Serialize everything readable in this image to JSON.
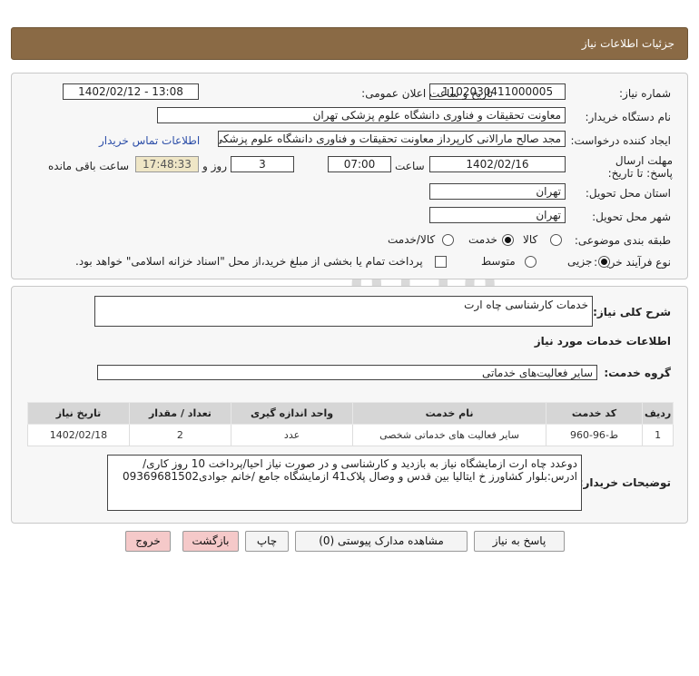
{
  "header": {
    "title": "جزئیات اطلاعات نیاز"
  },
  "form": {
    "need_number_label": "شماره نیاز:",
    "need_number": "1102030411000005",
    "announce_label": "تاریخ و ساعت اعلان عمومی:",
    "announce_value": "1402/02/12 - 13:08",
    "buyer_org_label": "نام دستگاه خریدار:",
    "buyer_org": "معاونت تحقیقات و فناوری دانشگاه علوم پزشکی تهران",
    "creator_label": "ایجاد کننده درخواست:",
    "creator": "مجد صالح مارالانی کارپرداز معاونت تحقیقات و فناوری دانشگاه علوم پزشکی تهران",
    "contact_link": "اطلاعات تماس خریدار",
    "deadline_label": "مهلت ارسال پاسخ: تا تاریخ:",
    "deadline_date": "1402/02/16",
    "time_label": "ساعت",
    "deadline_time": "07:00",
    "days": "3",
    "days_label": "روز و",
    "remaining": "17:48:33",
    "remaining_label": "ساعت باقی مانده",
    "province_label": "استان محل تحویل:",
    "province": "تهران",
    "city_label": "شهر محل تحویل:",
    "city": "تهران",
    "category_label": "طبقه بندی موضوعی:",
    "category_options": [
      "کالا",
      "خدمت",
      "کالا/خدمت"
    ],
    "category_selected": "خدمت",
    "process_label": "نوع فرآیند خرید :",
    "process_options": [
      "جزیی",
      "متوسط"
    ],
    "process_selected": "جزیی",
    "payment_note": "پرداخت تمام یا بخشی از مبلغ خرید،از محل \"اسناد خزانه اسلامی\" خواهد بود."
  },
  "details": {
    "summary_label": "شرح کلی نیاز:",
    "summary": "خدمات کارشناسی چاه ارت",
    "services_heading": "اطلاعات خدمات مورد نیاز",
    "service_group_label": "گروه خدمت:",
    "service_group": "سایر فعالیت‌های خدماتی",
    "table": {
      "headers": [
        "ردیف",
        "کد خدمت",
        "نام خدمت",
        "واحد اندازه گیری",
        "تعداد / مقدار",
        "تاریخ نیاز"
      ],
      "rows": [
        [
          "1",
          "ط-96-960",
          "سایر فعالیت های خدماتی شخصی",
          "عدد",
          "2",
          "1402/02/18"
        ]
      ]
    },
    "buyer_notes_label": "توضیحات خریدار:",
    "buyer_notes": "دوعدد چاه ارت ازمایشگاه نیاز به بازدید و کارشناسی و در صورت نیاز احیا/پرداخت 10 روز کاری/ادرس:بلوار کشاورز خ ایتالیا بین قدس و وصال پلاک41 ازمایشگاه جامع /خانم جوادی09369681502"
  },
  "buttons": {
    "reply": "پاسخ به نیاز",
    "attachments": "مشاهده مدارک پیوستی (0)",
    "print": "چاپ",
    "back": "بازگشت",
    "exit": "خروج"
  },
  "colors": {
    "header_bg": "#8a6a45",
    "link": "#2c4ea8",
    "remaining_bg": "#efe6c6",
    "exit_bg": "#f5c9c9"
  }
}
